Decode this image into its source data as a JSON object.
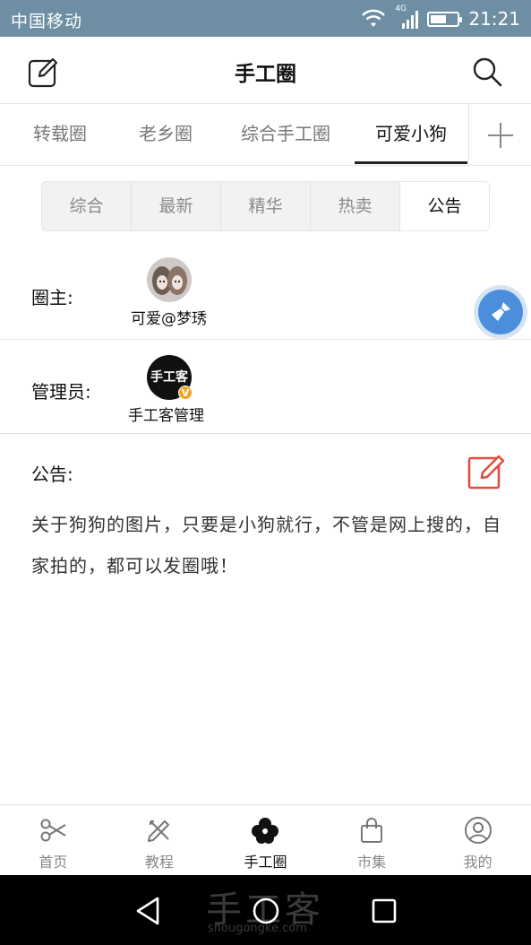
{
  "status_bar": {
    "carrier": "中国移动",
    "network_tag": "4G",
    "time": "21:21",
    "battery_level": 0.6
  },
  "header": {
    "title": "手工圈",
    "edit_icon": "edit-icon",
    "search_icon": "search-icon"
  },
  "circle_tabs": [
    {
      "label": "转载圈",
      "active": false
    },
    {
      "label": "老乡圈",
      "active": false
    },
    {
      "label": "综合手工圈",
      "active": false
    },
    {
      "label": "可爱小狗",
      "active": true
    }
  ],
  "segment_tabs": [
    {
      "label": "综合",
      "active": false
    },
    {
      "label": "最新",
      "active": false
    },
    {
      "label": "精华",
      "active": false
    },
    {
      "label": "热卖",
      "active": false
    },
    {
      "label": "公告",
      "active": true
    }
  ],
  "owner": {
    "label": "圈主:",
    "name": "可爱@梦琇"
  },
  "admin": {
    "label": "管理员:",
    "name": "手工客管理",
    "badge": "V",
    "avatar_text": "手工客"
  },
  "notice": {
    "label": "公告:",
    "text": "关于狗狗的图片，只要是小狗就行，不管是网上搜的，自家拍的，都可以发圈哦！"
  },
  "bottom_nav": [
    {
      "label": "首页",
      "icon": "scissors-icon",
      "active": false
    },
    {
      "label": "教程",
      "icon": "pencil-ruler-icon",
      "active": false
    },
    {
      "label": "手工圈",
      "icon": "flower-icon",
      "active": true
    },
    {
      "label": "市集",
      "icon": "shopping-bag-icon",
      "active": false
    },
    {
      "label": "我的",
      "icon": "user-icon",
      "active": false
    }
  ],
  "watermark": {
    "title": "手工客",
    "url": "shougongke.com"
  },
  "colors": {
    "status_bar": "#6d8ea3",
    "notice_edit": "#e0503f",
    "fab": "#4b8fdc",
    "badge": "#f3a521"
  }
}
